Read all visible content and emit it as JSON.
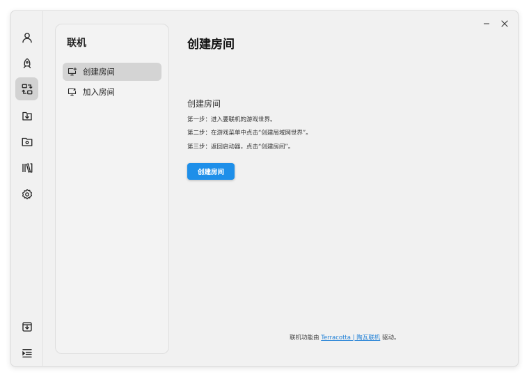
{
  "window": {
    "minimize_icon": "minimize-icon",
    "close_icon": "close-icon"
  },
  "rail": {
    "items": [
      {
        "name": "account",
        "icon": "user-icon",
        "active": false
      },
      {
        "name": "instance",
        "icon": "rocket-icon",
        "active": false
      },
      {
        "name": "multiplayer",
        "icon": "network-icon",
        "active": true
      },
      {
        "name": "download",
        "icon": "download-box-icon",
        "active": false
      },
      {
        "name": "folder",
        "icon": "folder-icon",
        "active": false
      },
      {
        "name": "library",
        "icon": "library-icon",
        "active": false
      },
      {
        "name": "settings",
        "icon": "gear-icon",
        "active": false
      }
    ],
    "bottom_items": [
      {
        "name": "download-tasks",
        "icon": "tray-download-icon"
      },
      {
        "name": "collapse-menu",
        "icon": "menu-collapse-icon"
      }
    ]
  },
  "subpanel": {
    "title": "联机",
    "items": [
      {
        "label": "创建房间",
        "icon": "monitor-plus-icon",
        "active": true
      },
      {
        "label": "加入房间",
        "icon": "monitor-join-icon",
        "active": false
      }
    ]
  },
  "main": {
    "page_title": "创建房间",
    "section_title": "创建房间",
    "steps": [
      "第一步：进入要联机的游戏世界。",
      "第二步：在游戏菜单中点击“创建局域网世界”。",
      "第三步：返回启动器，点击“创建房间”。"
    ],
    "create_button_label": "创建房间"
  },
  "footer": {
    "prefix": "联机功能由 ",
    "link_text": "Terracotta | 陶瓦联机",
    "suffix": " 驱动。"
  },
  "colors": {
    "accent": "#1e8fe9",
    "link": "#1e7fd6",
    "active_bg": "#d2d2d2"
  }
}
